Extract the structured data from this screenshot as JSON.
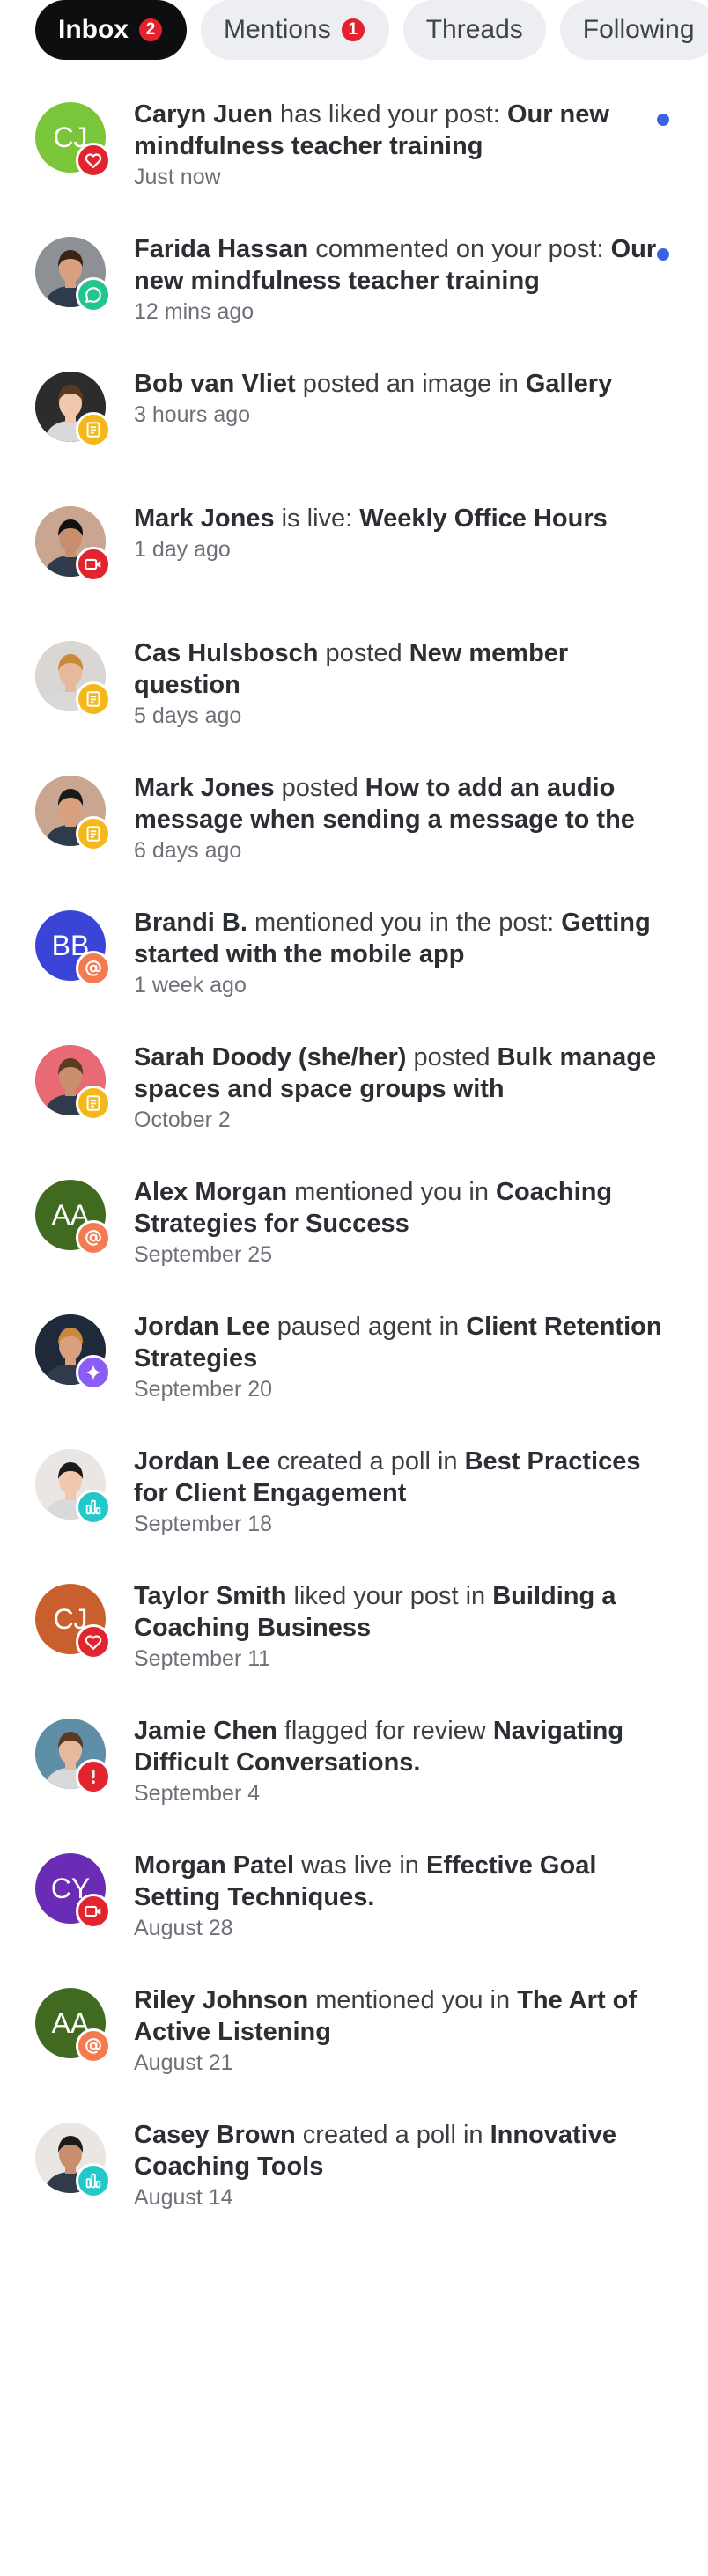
{
  "tabs": [
    {
      "label": "Inbox",
      "count": "2",
      "active": true
    },
    {
      "label": "Mentions",
      "count": "1",
      "active": false
    },
    {
      "label": "Threads",
      "count": "",
      "active": false
    },
    {
      "label": "Following",
      "count": "",
      "active": false
    }
  ],
  "badge_colors": {
    "like": "#e1242e",
    "comment": "#22c58d",
    "post": "#f5b719",
    "live": "#e1242e",
    "mention": "#f47a52",
    "agent": "#8b5cf6",
    "poll": "#23c9c9",
    "flag": "#e1242e"
  },
  "notifications": [
    {
      "actor": "Caryn Juen",
      "action": " has liked your post: ",
      "target": "Our new mindfulness teacher training",
      "time": "Just now",
      "unread": true,
      "avatar": {
        "initials": "CJ",
        "color": "#7bc53a"
      },
      "badge": "like",
      "badge_icon": "heart-icon"
    },
    {
      "actor": "Farida Hassan",
      "action": " commented on your post: ",
      "target": "Our new mindfulness teacher training",
      "time": "12 mins ago",
      "unread": true,
      "avatar": {
        "initials": "",
        "color": "#8d9196"
      },
      "badge": "comment",
      "badge_icon": "comment-icon"
    },
    {
      "actor": "Bob van Vliet",
      "action": " posted an image in ",
      "target": "Gallery",
      "time": "3 hours ago",
      "unread": false,
      "avatar": {
        "initials": "",
        "color": "#2c2c2c"
      },
      "badge": "post",
      "badge_icon": "post-icon"
    },
    {
      "actor": "Mark Jones",
      "action": " is live: ",
      "target": "Weekly Office Hours",
      "time": "1 day ago",
      "unread": false,
      "avatar": {
        "initials": "",
        "color": "#caa58f"
      },
      "badge": "live",
      "badge_icon": "video-icon"
    },
    {
      "actor": "Cas Hulsbosch",
      "action": " posted ",
      "target": "New member question",
      "time": "5 days ago",
      "unread": false,
      "avatar": {
        "initials": "",
        "color": "#d9d6d4"
      },
      "badge": "post",
      "badge_icon": "post-icon"
    },
    {
      "actor": "Mark Jones",
      "action": " posted ",
      "target": "How to add an audio message when sending a message to the",
      "time": "6 days ago",
      "unread": false,
      "avatar": {
        "initials": "",
        "color": "#caa58f"
      },
      "badge": "post",
      "badge_icon": "post-icon"
    },
    {
      "actor": "Brandi B.",
      "action": " mentioned you in the post: ",
      "target": "Getting started with the mobile app",
      "time": "1 week ago",
      "unread": false,
      "avatar": {
        "initials": "BB",
        "color": "#3a45d8"
      },
      "badge": "mention",
      "badge_icon": "at-icon"
    },
    {
      "actor": "Sarah Doody (she/her)",
      "action": " posted ",
      "target": "Bulk manage spaces and space groups with",
      "time": "October 2",
      "unread": false,
      "avatar": {
        "initials": "",
        "color": "#e86a74"
      },
      "badge": "post",
      "badge_icon": "post-icon"
    },
    {
      "actor": "Alex Morgan",
      "action": " mentioned you in ",
      "target": "Coaching Strategies for Success",
      "time": "September 25",
      "unread": false,
      "avatar": {
        "initials": "AA",
        "color": "#3f6a1f"
      },
      "badge": "mention",
      "badge_icon": "at-icon"
    },
    {
      "actor": "Jordan Lee",
      "action": " paused agent in ",
      "target": "Client Retention Strategies",
      "time": "September 20",
      "unread": false,
      "avatar": {
        "initials": "",
        "color": "#1e2a3a"
      },
      "badge": "agent",
      "badge_icon": "sparkle-icon"
    },
    {
      "actor": "Jordan Lee",
      "action": " created a poll in ",
      "target": "Best Practices for Client Engagement",
      "time": "September 18",
      "unread": false,
      "avatar": {
        "initials": "",
        "color": "#e9e6e4"
      },
      "badge": "poll",
      "badge_icon": "poll-icon"
    },
    {
      "actor": "Taylor Smith",
      "action": " liked your post in ",
      "target": "Building a Coaching Business",
      "time": "September 11",
      "unread": false,
      "avatar": {
        "initials": "CJ",
        "color": "#c85f2c"
      },
      "badge": "like",
      "badge_icon": "heart-icon"
    },
    {
      "actor": "Jamie Chen",
      "action": " flagged for review ",
      "target": "Navigating Difficult Conversations.",
      "time": "September 4",
      "unread": false,
      "avatar": {
        "initials": "",
        "color": "#5e8fa7"
      },
      "badge": "flag",
      "badge_icon": "alert-icon"
    },
    {
      "actor": "Morgan Patel",
      "action": " was live in ",
      "target": "Effective Goal Setting Techniques.",
      "time": "August 28",
      "unread": false,
      "avatar": {
        "initials": "CY",
        "color": "#6a2bb5"
      },
      "badge": "live",
      "badge_icon": "video-icon"
    },
    {
      "actor": "Riley Johnson",
      "action": " mentioned you in ",
      "target": "The Art of Active Listening",
      "time": "August 21",
      "unread": false,
      "avatar": {
        "initials": "AA",
        "color": "#3f6a1f"
      },
      "badge": "mention",
      "badge_icon": "at-icon"
    },
    {
      "actor": "Casey Brown",
      "action": " created a poll in ",
      "target": "Innovative Coaching Tools",
      "time": "August 14",
      "unread": false,
      "avatar": {
        "initials": "",
        "color": "#e9e6e4"
      },
      "badge": "poll",
      "badge_icon": "poll-icon"
    }
  ]
}
